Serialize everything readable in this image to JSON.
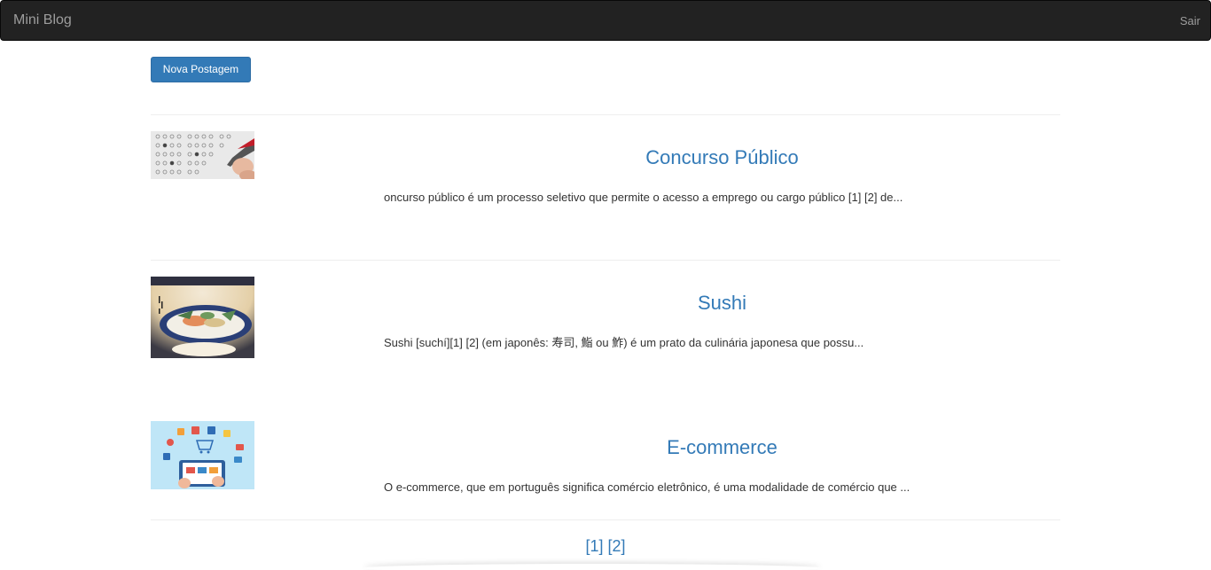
{
  "navbar": {
    "brand": "Mini Blog",
    "logout_label": "Sair"
  },
  "actions": {
    "new_post_label": "Nova Postagem"
  },
  "posts": [
    {
      "title": "Concurso Público",
      "excerpt": "oncurso público é um processo seletivo que permite o acesso a emprego ou cargo público [1] [2] de...",
      "image_icon": "exam-answer-sheet-image"
    },
    {
      "title": "Sushi",
      "excerpt": "Sushi [suchí][1] [2] (em japonês: 寿司, 鮨 ou 鮓) é um prato da culinária japonesa que possu...",
      "image_icon": "sushi-painting-image"
    },
    {
      "title": "E-commerce",
      "excerpt": "O e-commerce, que em português significa comércio eletrônico, é uma modalidade de comércio que ...",
      "image_icon": "ecommerce-tablet-image"
    }
  ],
  "pagination": {
    "page_1": "[1]",
    "page_2": "[2]"
  },
  "colors": {
    "navbar_bg": "#222222",
    "link": "#337ab7",
    "button_bg": "#337ab7"
  }
}
